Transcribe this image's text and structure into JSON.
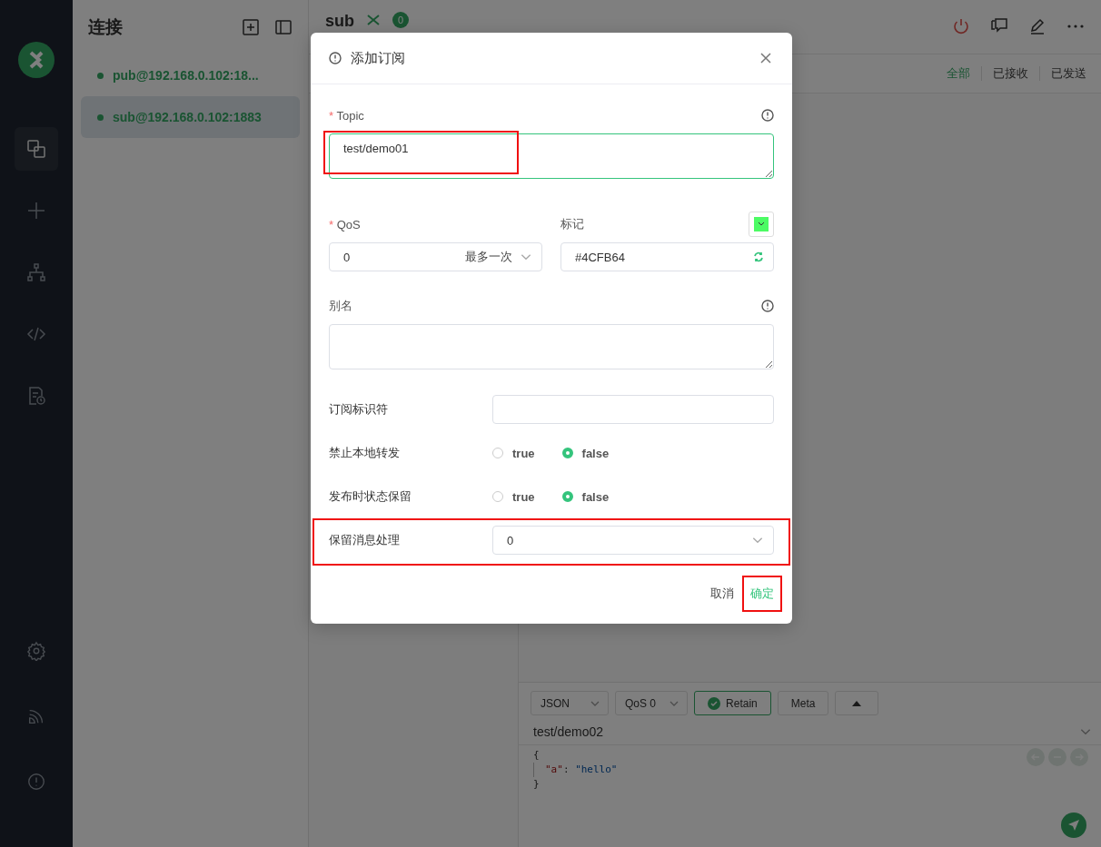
{
  "nav_items": [
    {
      "kind": "connections",
      "selected": true
    },
    {
      "kind": "new",
      "selected": false
    },
    {
      "kind": "topology",
      "selected": false
    },
    {
      "kind": "script",
      "selected": false
    },
    {
      "kind": "log",
      "selected": false
    }
  ],
  "nav_bottom": [
    {
      "kind": "settings"
    },
    {
      "kind": "feed"
    },
    {
      "kind": "about"
    }
  ],
  "connections": {
    "title": "连接",
    "items": [
      {
        "name": "pub@192.168.0.102:18...",
        "selected": false
      },
      {
        "name": "sub@192.168.0.102:1883",
        "selected": true
      }
    ]
  },
  "main": {
    "title": "sub",
    "badge": "0",
    "filters": [
      {
        "label": "全部",
        "selected": true
      },
      {
        "label": "已接收",
        "selected": false
      },
      {
        "label": "已发送",
        "selected": false
      }
    ]
  },
  "composer": {
    "format": "JSON",
    "qos": "QoS 0",
    "retain": {
      "label": "Retain",
      "checked": true
    },
    "meta": "Meta",
    "topic": "test/demo02",
    "code": [
      {
        "kind": "brace",
        "text": "{"
      },
      {
        "kind": "pair",
        "key": "\"a\"",
        "sep": ": ",
        "value": "\"hello\""
      },
      {
        "kind": "brace",
        "text": "}"
      }
    ]
  },
  "dialog": {
    "title": "添加订阅",
    "topic": {
      "label": "Topic",
      "required_mark": "*",
      "value": "test/demo01",
      "highlighted": true
    },
    "qos": {
      "label": "QoS",
      "required_mark": "*",
      "value": "0",
      "hint": "最多一次"
    },
    "mark": {
      "label": "标记",
      "color": "#4cfb64",
      "value": "#4CFB64"
    },
    "alias": {
      "label": "别名"
    },
    "sub_id": {
      "label": "订阅标识符"
    },
    "radios": [
      {
        "label": "禁止本地转发",
        "options": [
          {
            "label": "true",
            "selected": false
          },
          {
            "label": "false",
            "selected": true
          }
        ]
      },
      {
        "label": "发布时状态保留",
        "options": [
          {
            "label": "true",
            "selected": false
          },
          {
            "label": "false",
            "selected": true
          }
        ]
      }
    ],
    "retain_handling": {
      "label": "保留消息处理",
      "value": "0",
      "highlighted": true
    },
    "cancel": "取消",
    "confirm": {
      "label": "确定",
      "highlighted": true
    }
  }
}
